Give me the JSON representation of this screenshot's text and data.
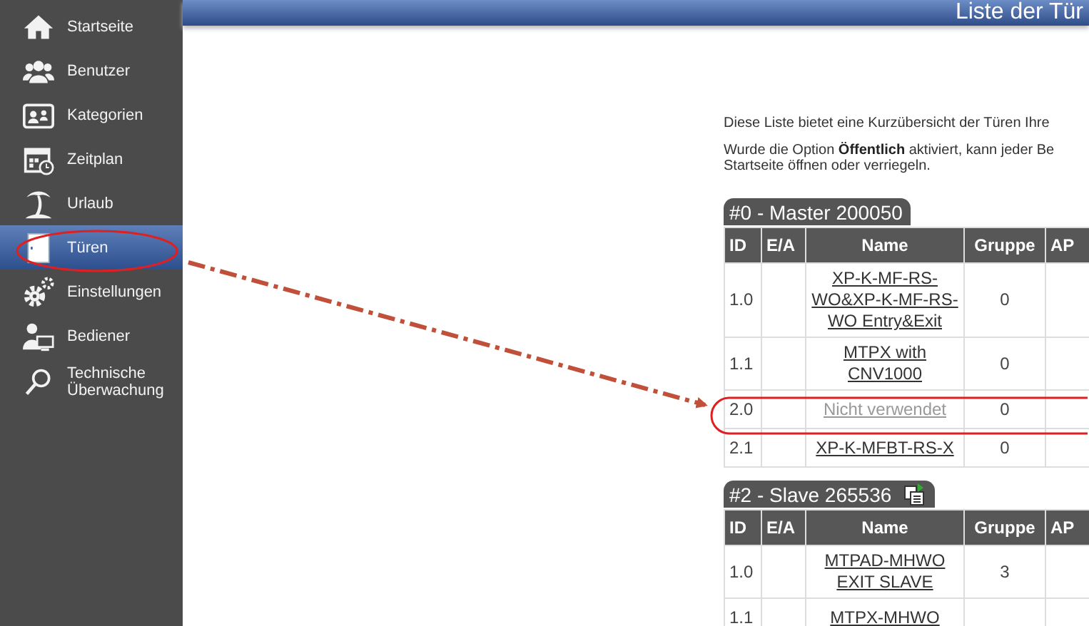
{
  "sidebar": {
    "items": [
      {
        "label": "Startseite",
        "selected": false
      },
      {
        "label": "Benutzer",
        "selected": false
      },
      {
        "label": "Kategorien",
        "selected": false
      },
      {
        "label": "Zeitplan",
        "selected": false
      },
      {
        "label": "Urlaub",
        "selected": false
      },
      {
        "label": "Türen",
        "selected": true
      },
      {
        "label": "Einstellungen",
        "selected": false
      },
      {
        "label": "Bediener",
        "selected": false
      },
      {
        "label": "Technische Überwachung",
        "selected": false
      }
    ]
  },
  "header": {
    "title": "Liste der Tür"
  },
  "intro": [
    "Diese Liste bietet eine Kurzübersicht der Türen Ihre"
  ],
  "option_text": [
    "Wurde die Option **Öffentlich** aktiviert, kann jeder Be",
    "Startseite öffnen oder verriegeln."
  ],
  "groups": [
    {
      "title": "#0 - Master 200050",
      "kind": "master",
      "columns": [
        "ID",
        "E/A",
        "Name",
        "Gruppe",
        "AP"
      ],
      "rows": [
        {
          "id": "1.0",
          "name": "XP-K-MF-RS-WO&XP-K-MF-RS-WO Entry&Exit",
          "gruppe": "0",
          "disabled": false
        },
        {
          "id": "1.1",
          "name": "MTPX with CNV1000",
          "gruppe": "0",
          "disabled": false
        },
        {
          "id": "2.0",
          "name": "Nicht verwendet",
          "gruppe": "0",
          "disabled": true
        },
        {
          "id": "2.1",
          "name": "XP-K-MFBT-RS-X",
          "gruppe": "0",
          "disabled": false
        }
      ]
    },
    {
      "title": "#2 - Slave 265536",
      "kind": "slave",
      "columns": [
        "ID",
        "E/A",
        "Name",
        "Gruppe",
        "AP"
      ],
      "rows": [
        {
          "id": "1.0",
          "name": "MTPAD-MHWO EXIT SLAVE",
          "gruppe": "3",
          "disabled": false
        },
        {
          "id": "1.1",
          "name": "MTPX-MHWO",
          "disabled": false
        }
      ]
    }
  ]
}
